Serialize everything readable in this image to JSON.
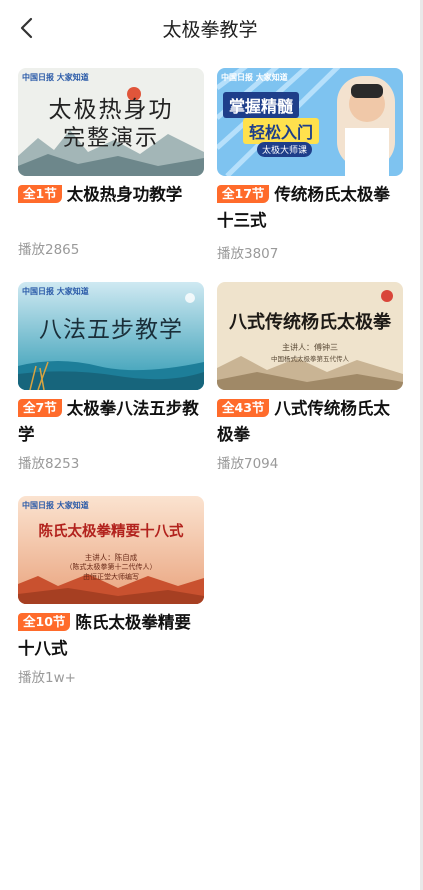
{
  "header": {
    "title": "太极拳教学"
  },
  "courses": [
    {
      "badge": "全1节",
      "title": "太极热身功教学",
      "plays": "播放2865",
      "thumb": {
        "line1": "太极热身功",
        "line2": "完整演示",
        "logo": "中国日报 大家知道"
      }
    },
    {
      "badge": "全17节",
      "title": "传统杨氏太极拳十三式",
      "plays": "播放3807",
      "thumb": {
        "line1": "掌握精髓",
        "line2": "轻松入门",
        "tag": "太极大师课",
        "logo": "中国日报 大家知道"
      }
    },
    {
      "badge": "全7节",
      "title": "太极拳八法五步教学",
      "plays": "播放8253",
      "thumb": {
        "line1": "八法五步教学",
        "logo": "中国日报 大家知道"
      }
    },
    {
      "badge": "全43节",
      "title": "八式传统杨氏太极拳",
      "plays": "播放7094",
      "thumb": {
        "line1": "八式传统杨氏太极拳",
        "sub1": "主讲人：傅钟三",
        "sub2": "中国杨式太极拳第五代传人"
      }
    },
    {
      "badge": "全10节",
      "title": "陈氏太极拳精要十八式",
      "plays": "播放1w+",
      "thumb": {
        "line1": "陈氏太极拳精要十八式",
        "sub1": "主讲人：陈自成",
        "sub2": "（陈式太极拳第十二代传人）",
        "sub3": "由恒正堂大师编写",
        "logo": "中国日报 大家知道"
      }
    }
  ],
  "colors": {
    "badge": "#ff6b2b",
    "plays": "#9a9a9a"
  }
}
